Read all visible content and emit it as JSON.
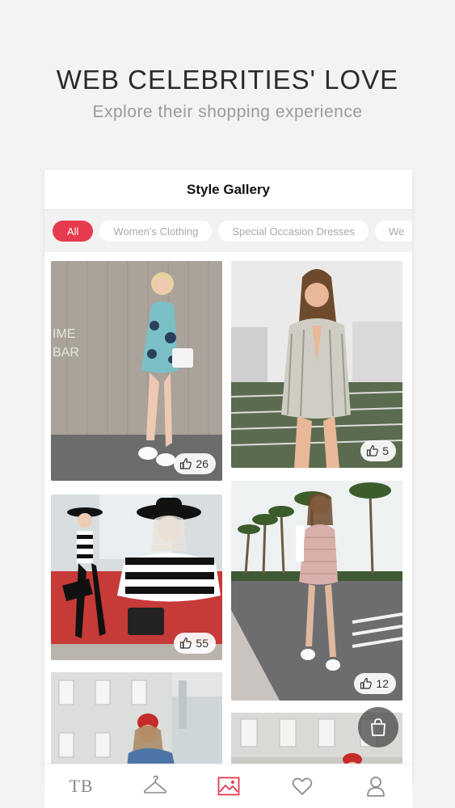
{
  "hero": {
    "title": "WEB CELEBRITIES' LOVE",
    "subtitle": "Explore their shopping experience"
  },
  "gallery": {
    "title": "Style Gallery",
    "filters": [
      "All",
      "Women's Clothing",
      "Special Occasion Dresses",
      "We"
    ],
    "active_filter": "All",
    "posts": [
      {
        "likes": "26",
        "outfit": "floral-romper",
        "bg": "concrete-wall"
      },
      {
        "likes": "5",
        "outfit": "striped-plunge-romper",
        "bg": "balcony"
      },
      {
        "likes": "55",
        "outfit": "black-white-striped-top",
        "bg": "red-wall"
      },
      {
        "likes": "12",
        "outfit": "pink-gingham-dress",
        "bg": "palm-street"
      },
      {
        "likes": "",
        "outfit": "red-beanie-denim",
        "bg": "building"
      },
      {
        "likes": "",
        "outfit": "red-hat",
        "bg": "building"
      }
    ]
  },
  "tabbar": {
    "logo": "TB",
    "items": [
      "home-logo",
      "hanger-icon",
      "gallery-icon",
      "heart-icon",
      "profile-icon"
    ],
    "active_index": 2
  },
  "colors": {
    "accent": "#e63a4f",
    "icon": "#8a8a8a"
  }
}
